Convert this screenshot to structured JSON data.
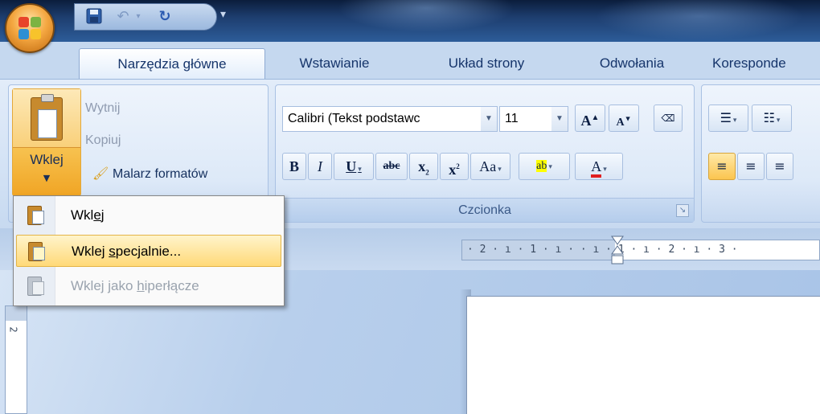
{
  "tabs": [
    {
      "label": "Narzędzia główne",
      "active": true
    },
    {
      "label": "Wstawianie"
    },
    {
      "label": "Układ strony"
    },
    {
      "label": "Odwołania"
    },
    {
      "label": "Koresponde"
    }
  ],
  "clipboard": {
    "paste_label": "Wklej",
    "cut_label": "Wytnij",
    "copy_label": "Kopiuj",
    "format_painter_label": "Malarz formatów"
  },
  "font_group": {
    "label": "Czcionka",
    "font_name": "Calibri (Tekst podstawc",
    "font_size": "11"
  },
  "paste_menu": {
    "items": [
      {
        "label_pre": "Wkl",
        "label_ul": "e",
        "label_post": "j",
        "state": "normal"
      },
      {
        "label_pre": "Wklej ",
        "label_ul": "s",
        "label_post": "pecjalnie...",
        "state": "highlighted"
      },
      {
        "label_pre": "Wklej jako ",
        "label_ul": "h",
        "label_post": "iperłącze",
        "state": "disabled"
      }
    ]
  },
  "ruler": {
    "horizontal": "· 2 · ı · 1 · ı ·    · ı · 1 · ı · 2 · ı · 3 ·",
    "vertical_number": "2"
  },
  "colors": {
    "accent_highlight": "#ffd978",
    "ribbon_bg": "#dde9f8",
    "tab_text": "#16356b"
  }
}
